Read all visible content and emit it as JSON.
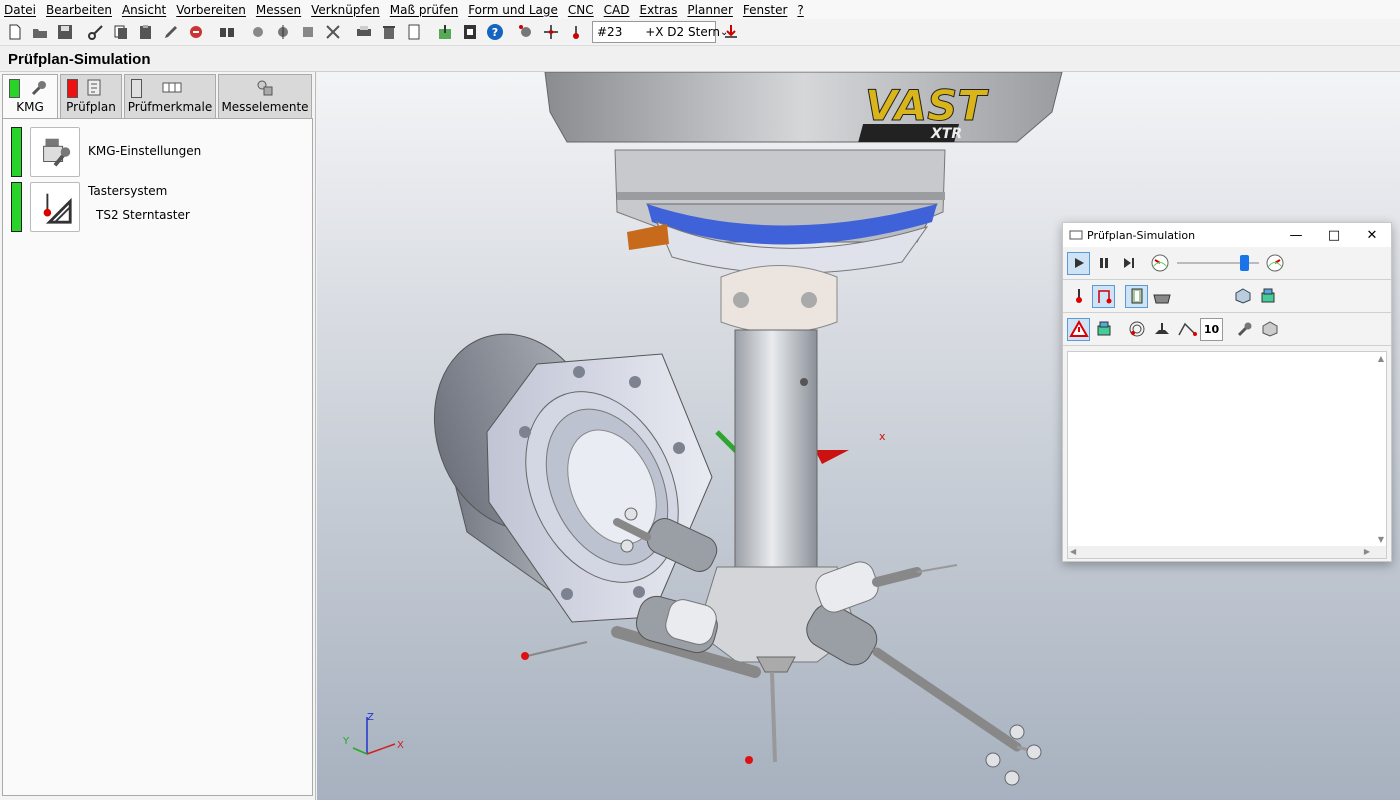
{
  "menu": [
    "Datei",
    "Bearbeiten",
    "Ansicht",
    "Vorbereiten",
    "Messen",
    "Verknüpfen",
    "Maß prüfen",
    "Form und Lage",
    "CNC",
    "CAD",
    "Extras",
    "Planner",
    "Fenster",
    "?"
  ],
  "toolbar": {
    "probe_selector_value": "#23      +X D2 Stern"
  },
  "window_title": "Prüfplan-Simulation",
  "tabs": [
    {
      "label": "KMG",
      "status_color": "#27d427"
    },
    {
      "label": "Prüfplan",
      "status_color": "#ee1111"
    },
    {
      "label": "Prüfmerkmale",
      "status_color": "#e0e0e0"
    },
    {
      "label": "Messelemente"
    }
  ],
  "kmg": {
    "settings_label": "KMG-Einstellungen",
    "probe_system_label": "Tastersystem",
    "probe_system_value": "TS2 Sterntaster"
  },
  "viewport": {
    "brand_main": "VAST",
    "brand_sub": "XTR",
    "axis_x": "X",
    "axis_y": "Y",
    "axis_z": "Z",
    "marker_x": "x"
  },
  "sim": {
    "title": "Prüfplan-Simulation",
    "count_value": "10",
    "speed_fraction": 0.82
  }
}
